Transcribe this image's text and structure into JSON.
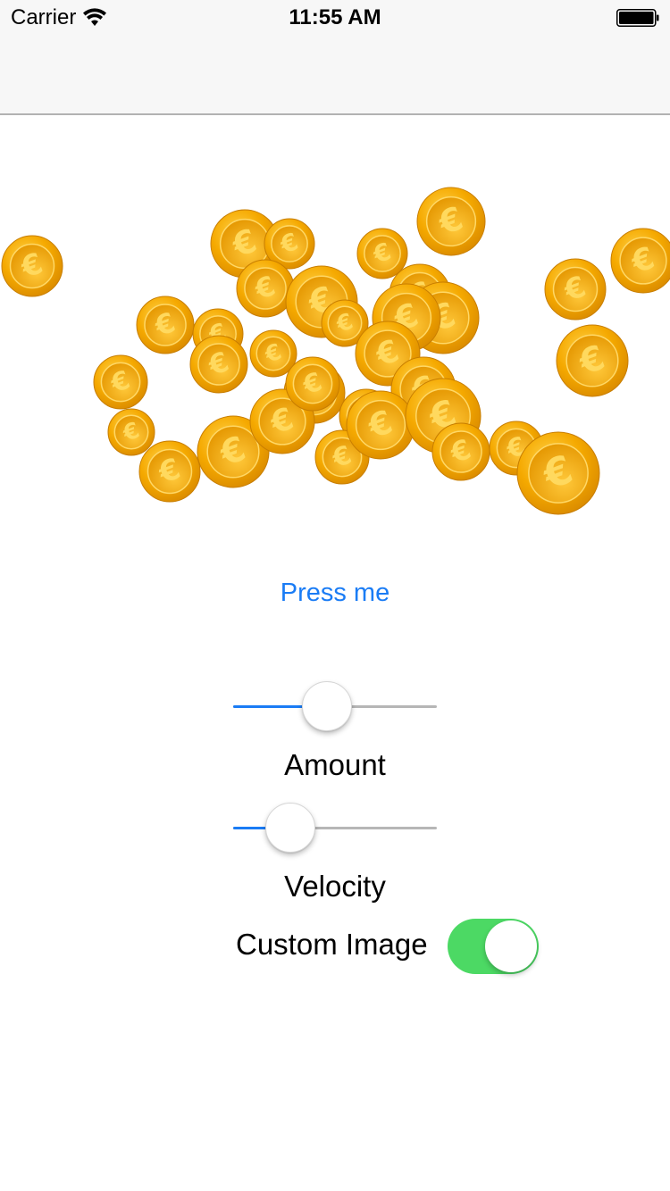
{
  "status_bar": {
    "carrier": "Carrier",
    "time": "11:55 AM",
    "icons": [
      "wifi-icon",
      "battery-icon"
    ]
  },
  "coin_emitter": {
    "coin_symbol": "€",
    "coin_color": "#f2a900"
  },
  "button": {
    "label": "Press me"
  },
  "sliders": [
    {
      "label": "Amount",
      "value": 0.46
    },
    {
      "label": "Velocity",
      "value": 0.28
    }
  ],
  "toggle": {
    "label": "Custom Image",
    "on": true
  },
  "colors": {
    "accent": "#1a7cf5",
    "switch_on": "#4cd964",
    "track": "#b6b6b6"
  }
}
